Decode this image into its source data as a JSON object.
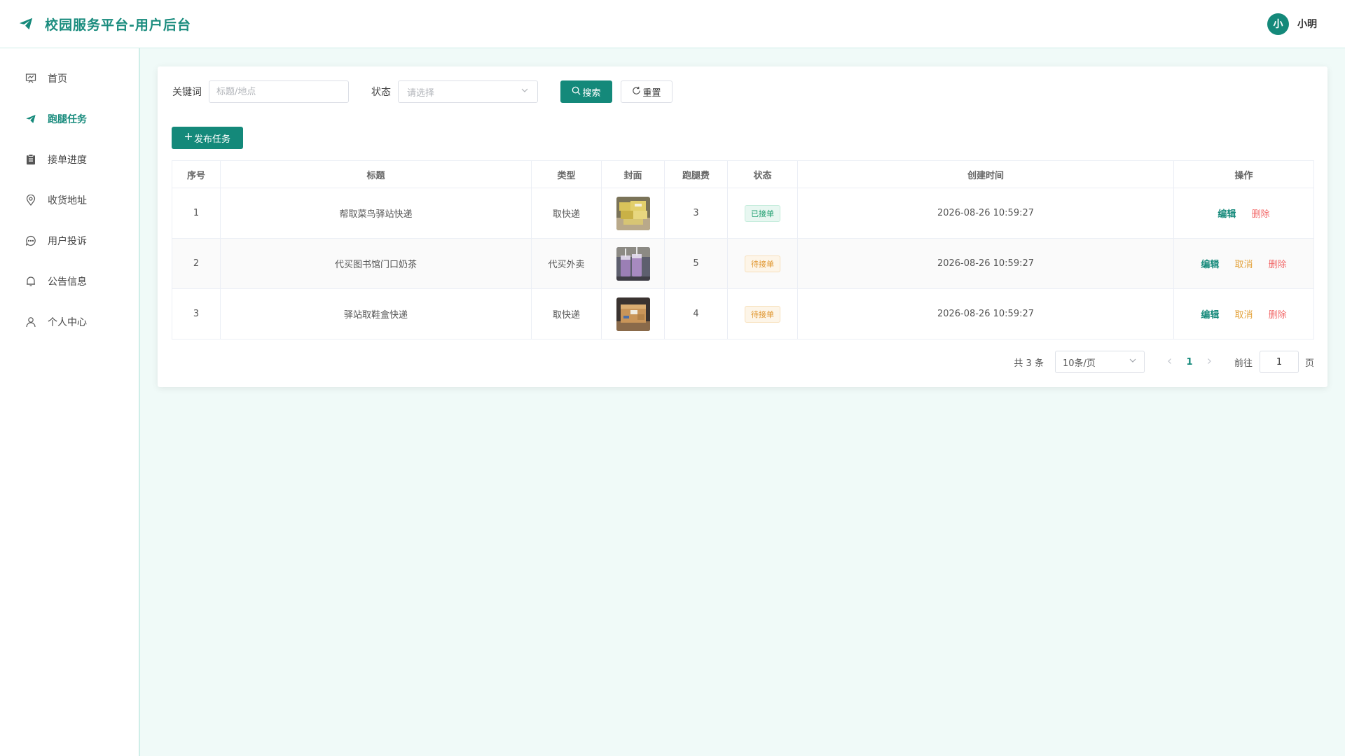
{
  "header": {
    "title": "校园服务平台-用户后台",
    "avatar_text": "小",
    "username": "小明"
  },
  "sidebar": {
    "items": [
      {
        "label": "首页",
        "icon": "presentation-icon",
        "active": false
      },
      {
        "label": "跑腿任务",
        "icon": "paper-plane-icon",
        "active": true
      },
      {
        "label": "接单进度",
        "icon": "clipboard-icon",
        "active": false
      },
      {
        "label": "收货地址",
        "icon": "location-pin-icon",
        "active": false
      },
      {
        "label": "用户投诉",
        "icon": "chat-bubble-icon",
        "active": false
      },
      {
        "label": "公告信息",
        "icon": "bell-icon",
        "active": false
      },
      {
        "label": "个人中心",
        "icon": "user-icon",
        "active": false
      }
    ]
  },
  "filters": {
    "keyword_label": "关键词",
    "keyword_placeholder": "标题/地点",
    "keyword_value": "",
    "status_label": "状态",
    "status_placeholder": "请选择",
    "search_label": "搜索",
    "reset_label": "重置"
  },
  "publish_label": "发布任务",
  "table": {
    "columns": [
      "序号",
      "标题",
      "类型",
      "封面",
      "跑腿费",
      "状态",
      "创建时间",
      "操作"
    ],
    "rows": [
      {
        "index": "1",
        "title": "帮取菜鸟驿站快递",
        "type": "取快递",
        "cover": "parcel-boxes-photo",
        "fee": "3",
        "status": "已接单",
        "created": "2026-08-26 10:59:27",
        "actions": [
          "编辑",
          "删除"
        ]
      },
      {
        "index": "2",
        "title": "代买图书馆门口奶茶",
        "type": "代买外卖",
        "cover": "milk-tea-photo",
        "fee": "5",
        "status": "待接单",
        "created": "2026-08-26 10:59:27",
        "actions": [
          "编辑",
          "取消",
          "删除"
        ]
      },
      {
        "index": "3",
        "title": "驿站取鞋盒快递",
        "type": "取快递",
        "cover": "shoebox-photo",
        "fee": "4",
        "status": "待接单",
        "created": "2026-08-26 10:59:27",
        "actions": [
          "编辑",
          "取消",
          "删除"
        ]
      }
    ]
  },
  "pagination": {
    "total_text": "共 3 条",
    "page_size": "10条/页",
    "current_page": "1",
    "goto_label": "前往",
    "goto_value": "1",
    "page_suffix": "页"
  },
  "colors": {
    "accent": "#14897a",
    "page_bg": "#f0faf8",
    "status_done": "#1a9c6c",
    "status_wait": "#e0952d",
    "delete": "#f26a6a"
  }
}
